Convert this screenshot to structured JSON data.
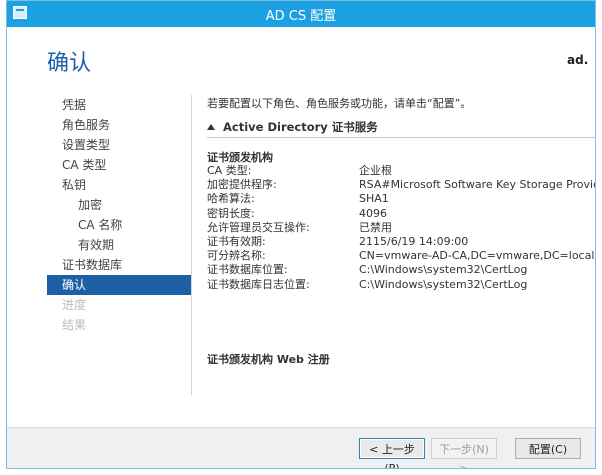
{
  "window": {
    "title": "AD CS 配置"
  },
  "page": {
    "title": "确认",
    "server_name": "ad."
  },
  "nav": {
    "items": [
      {
        "label": "凭据",
        "state": "normal",
        "level": 0
      },
      {
        "label": "角色服务",
        "state": "normal",
        "level": 0
      },
      {
        "label": "设置类型",
        "state": "normal",
        "level": 0
      },
      {
        "label": "CA 类型",
        "state": "normal",
        "level": 0
      },
      {
        "label": "私钥",
        "state": "normal",
        "level": 0
      },
      {
        "label": "加密",
        "state": "normal",
        "level": 1
      },
      {
        "label": "CA 名称",
        "state": "normal",
        "level": 1
      },
      {
        "label": "有效期",
        "state": "normal",
        "level": 1
      },
      {
        "label": "证书数据库",
        "state": "normal",
        "level": 0
      },
      {
        "label": "确认",
        "state": "selected",
        "level": 0
      },
      {
        "label": "进度",
        "state": "disabled",
        "level": 0
      },
      {
        "label": "结果",
        "state": "disabled",
        "level": 0
      }
    ]
  },
  "content": {
    "intro": "若要配置以下角色、角色服务或功能，请单击“配置”。",
    "section_title": "Active Directory 证书服务",
    "group1_title": "证书颁发机构",
    "rows": [
      {
        "key": "CA 类型:",
        "value": "企业根"
      },
      {
        "key": "加密提供程序:",
        "value": "RSA#Microsoft Software Key Storage Provider"
      },
      {
        "key": "哈希算法:",
        "value": "SHA1"
      },
      {
        "key": "密钥长度:",
        "value": "4096"
      },
      {
        "key": "允许管理员交互操作:",
        "value": "已禁用"
      },
      {
        "key": "证书有效期:",
        "value": "2115/6/19 14:09:00"
      },
      {
        "key": "可分辨名称:",
        "value": "CN=vmware-AD-CA,DC=vmware,DC=local"
      },
      {
        "key": "证书数据库位置:",
        "value": "C:\\Windows\\system32\\CertLog"
      },
      {
        "key": "证书数据库日志位置:",
        "value": "C:\\Windows\\system32\\CertLog"
      }
    ],
    "group2_title": "证书颁发机构 Web 注册"
  },
  "footer": {
    "prev_label": "< 上一步(P)",
    "next_label": "下一步(N) >",
    "configure_label": "配置(C)"
  },
  "colors": {
    "titlebar": "#1ba1e2",
    "page_title": "#1e5fa8",
    "nav_selected": "#1e60a6"
  }
}
